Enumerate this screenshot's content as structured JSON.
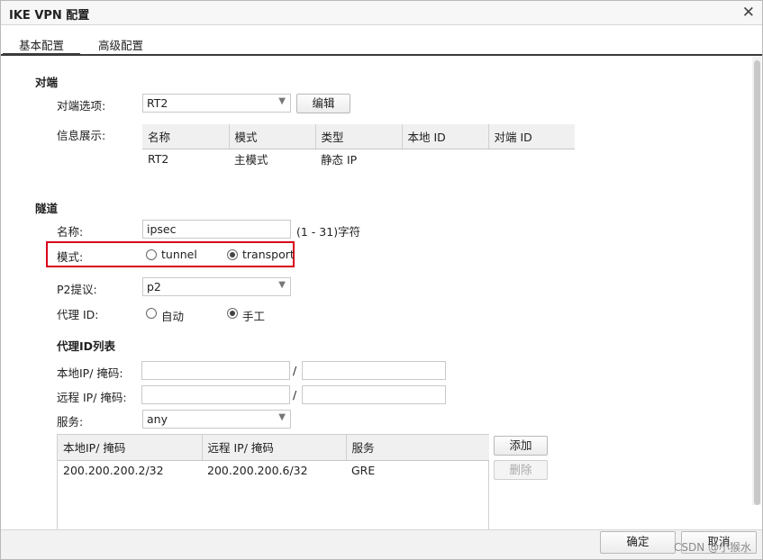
{
  "window": {
    "title": "IKE VPN 配置"
  },
  "tabs": [
    {
      "label": "基本配置"
    },
    {
      "label": "高级配置"
    }
  ],
  "peer": {
    "section": "对端",
    "option_label": "对端选项:",
    "option_value": "RT2",
    "edit_button": "编辑",
    "info_label": "信息展示:",
    "columns": [
      "名称",
      "模式",
      "类型",
      "本地 ID",
      "对端 ID"
    ],
    "rows": [
      [
        "RT2",
        "主模式",
        "静态 IP",
        "",
        ""
      ]
    ]
  },
  "tunnel": {
    "section": "隧道",
    "name_label": "名称:",
    "name_value": "ipsec",
    "name_hint": "(1 - 31)字符",
    "mode_label": "模式:",
    "mode_options": [
      "tunnel",
      "transport"
    ],
    "mode_selected": "transport",
    "p2_label": "P2提议:",
    "p2_value": "p2",
    "proxy_id_label": "代理 ID:",
    "proxy_id_options": [
      "自动",
      "手工"
    ],
    "proxy_id_selected": "手工"
  },
  "proxy_list": {
    "heading": "代理ID列表",
    "local_label": "本地IP/ 掩码:",
    "remote_label": "远程 IP/ 掩码:",
    "slash": "/",
    "service_label": "服务:",
    "service_value": "any",
    "columns": [
      "本地IP/ 掩码",
      "远程 IP/ 掩码",
      "服务"
    ],
    "rows": [
      [
        "200.200.200.2/32",
        "200.200.200.6/32",
        "GRE"
      ]
    ],
    "add_button": "添加",
    "delete_button": "删除"
  },
  "footer": {
    "ok_button": "确定",
    "cancel_button": "取消"
  },
  "watermark": "CSDN @小猴水"
}
